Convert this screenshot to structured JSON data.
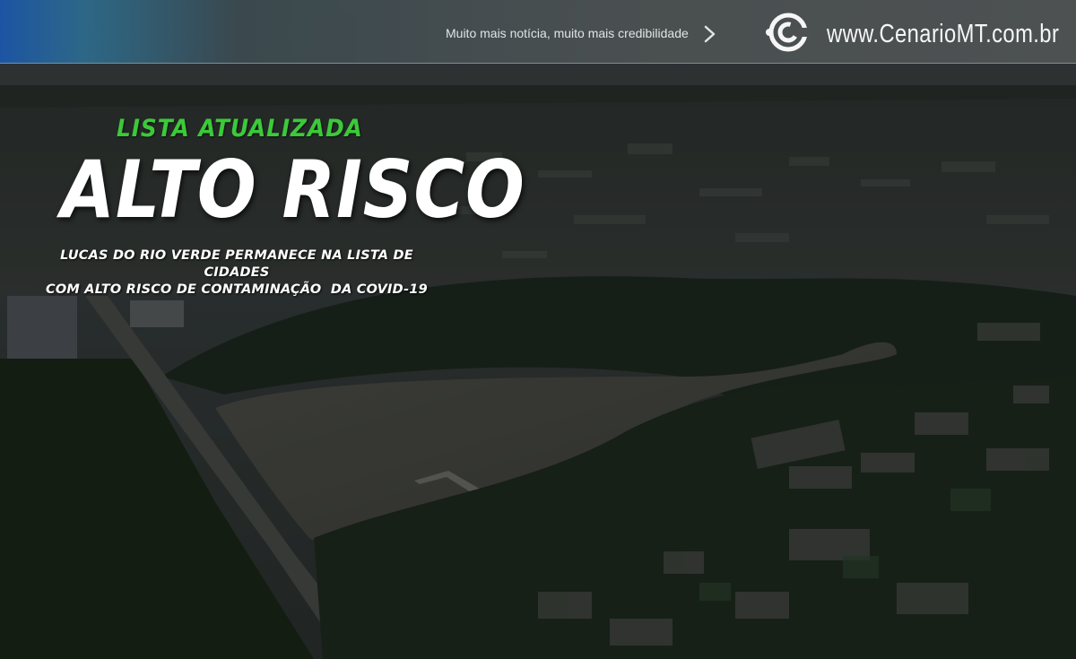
{
  "header": {
    "tagline": "Muito mais notícia, muito mais credibilidade",
    "site_url": "www.CenarioMT.com.br",
    "logo_icon": "cenario-c-logo-icon",
    "chevron_icon": "chevron-right-icon"
  },
  "headline": {
    "kicker": "LISTA ATUALIZADA",
    "main": "ALTO RISCO",
    "subtitle_line1": "LUCAS DO RIO VERDE PERMANECE NA LISTA DE CIDADES",
    "subtitle_line2": "COM ALTO RISCO DE CONTAMINAÇÃO  DA COVID-19"
  },
  "colors": {
    "kicker_green": "#3cc93a",
    "headline_white": "#ffffff",
    "bar_blue": "#1c57a8"
  }
}
